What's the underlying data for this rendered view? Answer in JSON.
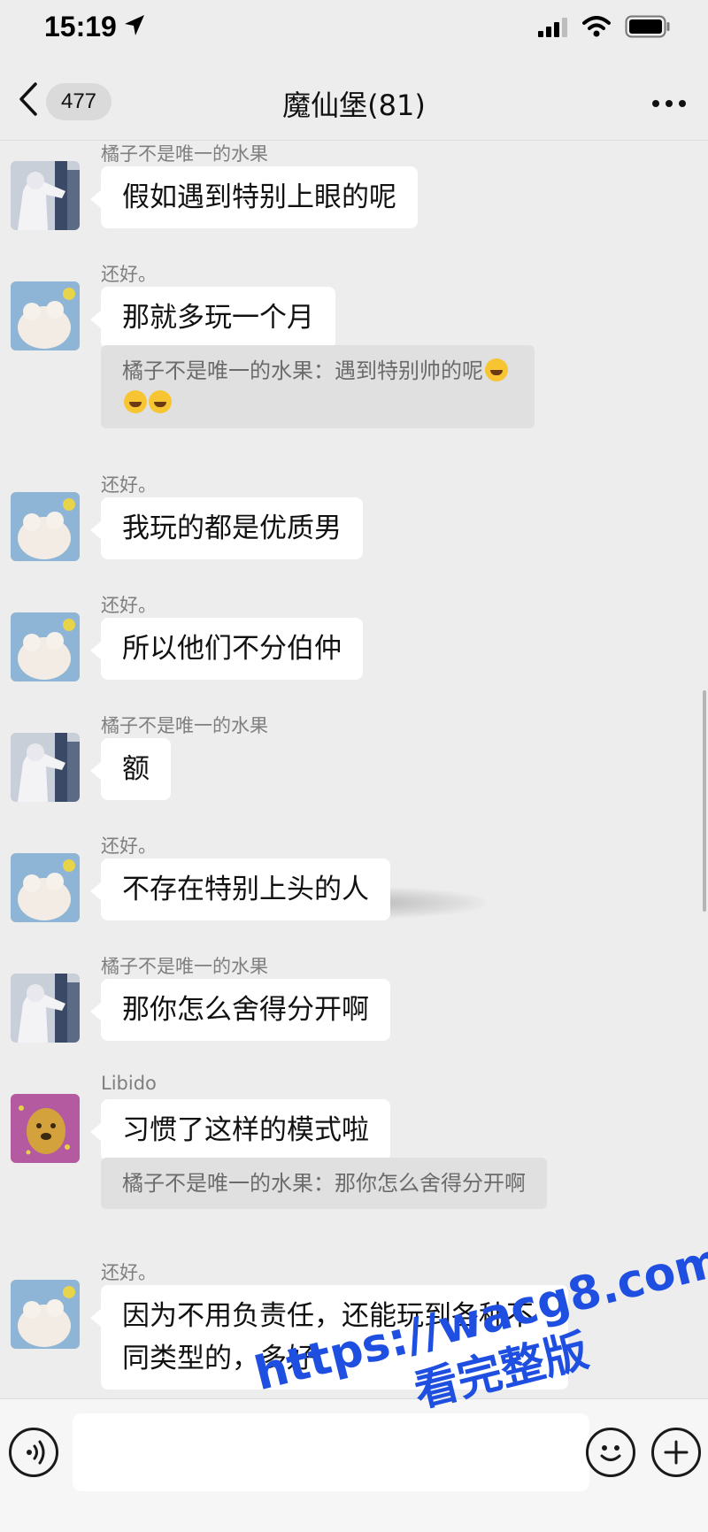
{
  "status": {
    "time": "15:19"
  },
  "header": {
    "back_count": "477",
    "title": "魔仙堡(81)"
  },
  "messages": [
    {
      "sender": "橘子不是唯一的水果",
      "text": "假如遇到特别上眼的呢",
      "avatar": "figure-avatar"
    },
    {
      "sender": "还好。",
      "text": "那就多玩一个月",
      "avatar": "plush-avatar",
      "quote": "橘子不是唯一的水果：遇到特别帅的呢",
      "quote_emojis": [
        "laugh-cry-emoji",
        "laugh-cry-emoji",
        "laugh-cry-emoji"
      ]
    },
    {
      "sender": "还好。",
      "text": "我玩的都是优质男",
      "avatar": "plush-avatar"
    },
    {
      "sender": "还好。",
      "text": "所以他们不分伯仲",
      "avatar": "plush-avatar"
    },
    {
      "sender": "橘子不是唯一的水果",
      "text": "额",
      "avatar": "figure-avatar"
    },
    {
      "sender": "还好。",
      "text": "不存在特别上头的人",
      "avatar": "plush-avatar"
    },
    {
      "sender": "橘子不是唯一的水果",
      "text": "那你怎么舍得分开啊",
      "avatar": "figure-avatar"
    },
    {
      "sender": "Libido",
      "text": "习惯了这样的模式啦",
      "avatar": "dog-avatar",
      "quote": "橘子不是唯一的水果：那你怎么舍得分开啊"
    },
    {
      "sender": "还好。",
      "text": "因为不用负责任，还能玩到各种不同类型的，多好",
      "avatar": "plush-avatar"
    }
  ],
  "watermark": {
    "line1": "https://wacg8.com",
    "line2": "看完整版"
  },
  "colors": {
    "background": "#ededed",
    "bubble": "#ffffff",
    "quote": "#e0e0e0",
    "watermark": "#1f4fe0"
  }
}
